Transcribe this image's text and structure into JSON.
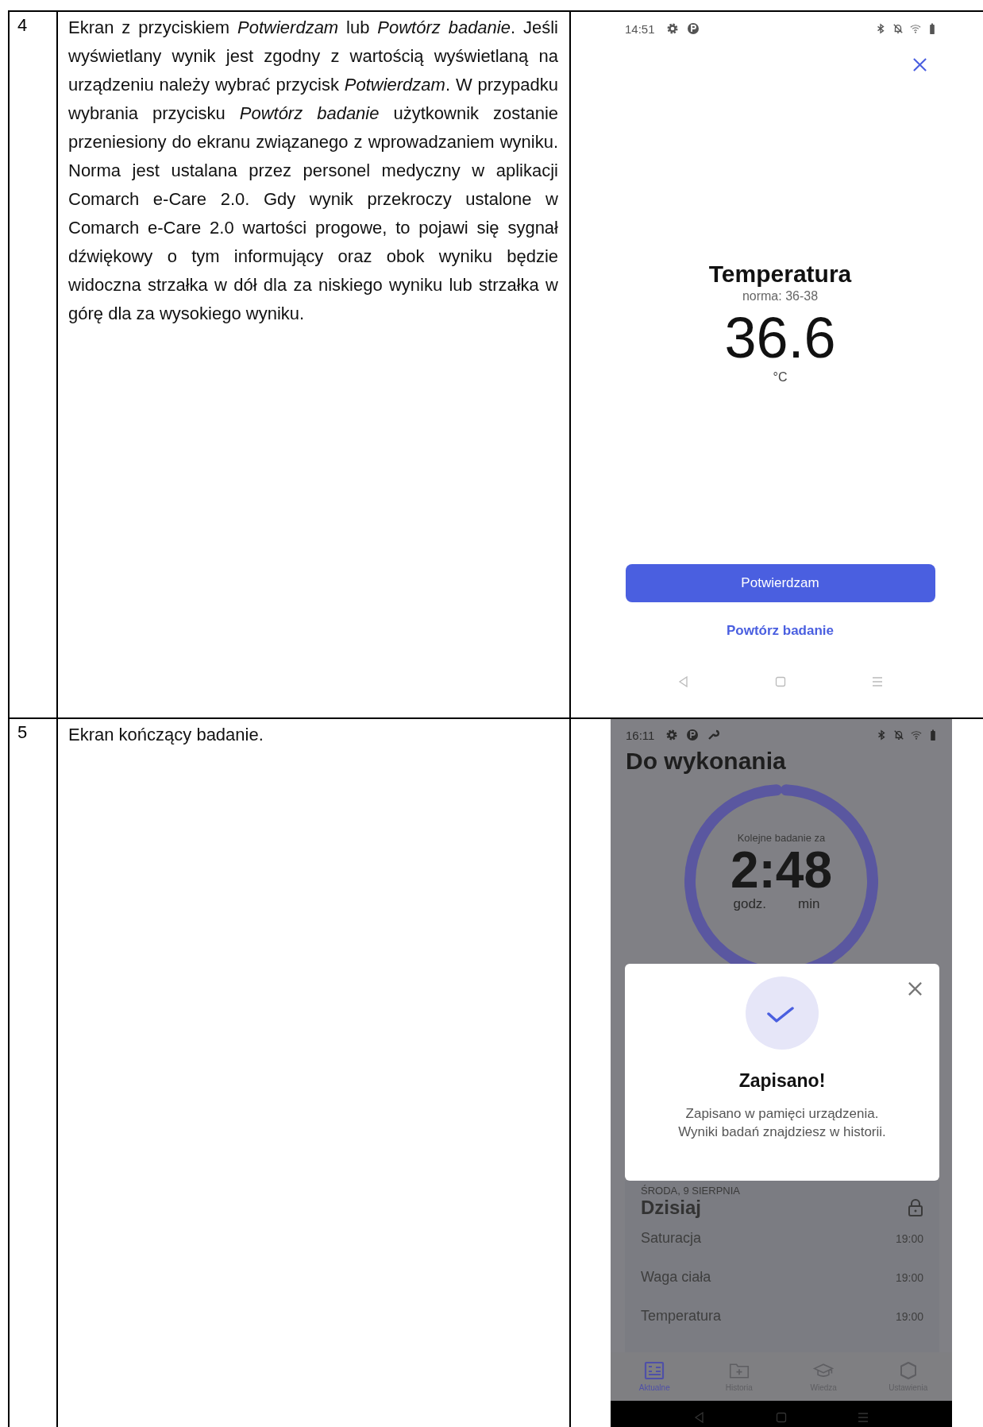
{
  "rows": [
    {
      "number": "4",
      "description": "Ekran z przyciskiem *Potwierdzam* lub *Powtórz badanie*. Jeśli wyświetlany wynik jest zgodny z wartością wyświetlaną na urządzeniu należy wybrać przycisk *Potwierdzam*. W przypadku wybrania przycisku *Powtórz badanie* użytkownik zostanie przeniesiony do ekranu związanego z wprowadzaniem wyniku. Norma jest ustalana przez personel medyczny w aplikacji Comarch e-Care 2.0. Gdy wynik przekroczy ustalone w Comarch e-Care 2.0 wartości progowe, to pojawi się sygnał dźwiękowy o tym informujący oraz obok wyniku będzie widoczna strzałka w dół dla za niskiego wyniku lub strzałka w górę dla za wysokiego wyniku.",
      "screen": {
        "kind": "result",
        "time": "14:51",
        "title": "Temperatura",
        "norm": "norma: 36-38",
        "value": "36.6",
        "unit": "°C",
        "confirm_button": "Potwierdzam",
        "repeat_link": "Powtórz badanie"
      }
    },
    {
      "number": "5",
      "description": "Ekran kończący badanie.",
      "screen": {
        "kind": "saved",
        "time": "16:11",
        "title": "Do wykonania",
        "countdown_label": "Kolejne badanie za",
        "countdown": "2:48",
        "hours_label": "godz.",
        "minutes_label": "min",
        "dialog": {
          "title": "Zapisano!",
          "message": [
            "Zapisano w pamięci urządzenia.",
            "Wyniki badań znajdziesz w historii."
          ]
        },
        "date": "ŚRODA, 9 SIERPNIA",
        "day": "Dzisiaj",
        "tasks": [
          {
            "name": "Saturacja",
            "time": "19:00"
          },
          {
            "name": "Waga ciała",
            "time": "19:00"
          },
          {
            "name": "Temperatura",
            "time": "19:00"
          }
        ],
        "nav": [
          {
            "label": "Aktualne",
            "selected": true
          },
          {
            "label": "Historia",
            "selected": false
          },
          {
            "label": "Wiedza",
            "selected": false
          },
          {
            "label": "Ustawienia",
            "selected": false
          }
        ]
      }
    }
  ]
}
